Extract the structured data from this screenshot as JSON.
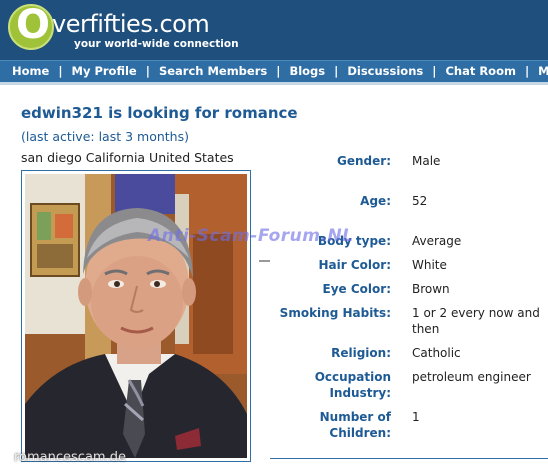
{
  "header": {
    "logo_o": "O",
    "logo_word": "verfifties.com",
    "tagline": "your world-wide connection"
  },
  "nav": {
    "items": [
      "Home",
      "My Profile",
      "Search Members",
      "Blogs",
      "Discussions",
      "Chat Room",
      "M"
    ],
    "separator": "|"
  },
  "profile": {
    "title": "edwin321 is looking for romance",
    "last_active": "(last active: last 3 months)",
    "location": "san diego California United States"
  },
  "details": [
    {
      "label": "Gender:",
      "value": "Male"
    },
    {
      "label": "Age:",
      "value": "52"
    },
    {
      "label": "Body type:",
      "value": "Average"
    },
    {
      "label": "Hair Color:",
      "value": "White"
    },
    {
      "label": "Eye Color:",
      "value": "Brown"
    },
    {
      "label": "Smoking Habits:",
      "value": "1 or 2 every now and then"
    },
    {
      "label": "Religion:",
      "value": "Catholic"
    },
    {
      "label": "Occupation Industry:",
      "value": "petroleum engineer"
    },
    {
      "label": "Number of Children:",
      "value": "1"
    }
  ],
  "overlays": {
    "watermark": "Anti-Scam-Forum.NL",
    "site_stamp": "romancescam.de"
  },
  "colors": {
    "header_bg": "#1f4f7c",
    "nav_bg": "#2f6ea5",
    "accent_text": "#1e5a94",
    "logo_green": "#9fc238"
  }
}
